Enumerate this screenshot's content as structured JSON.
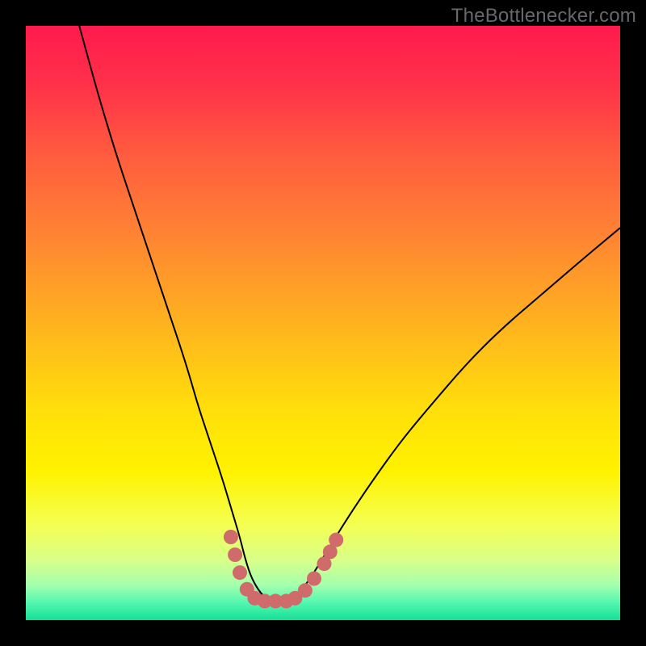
{
  "watermark": "TheBottlenecker.com",
  "gradient": {
    "stops": [
      {
        "offset": 0.0,
        "color": "#ff1a4d"
      },
      {
        "offset": 0.1,
        "color": "#ff3149"
      },
      {
        "offset": 0.22,
        "color": "#ff5d3e"
      },
      {
        "offset": 0.35,
        "color": "#ff8333"
      },
      {
        "offset": 0.5,
        "color": "#ffb21f"
      },
      {
        "offset": 0.65,
        "color": "#ffe00a"
      },
      {
        "offset": 0.75,
        "color": "#fff200"
      },
      {
        "offset": 0.84,
        "color": "#f4ff52"
      },
      {
        "offset": 0.9,
        "color": "#d8ff8a"
      },
      {
        "offset": 0.94,
        "color": "#a6ffad"
      },
      {
        "offset": 0.97,
        "color": "#55f7b0"
      },
      {
        "offset": 1.0,
        "color": "#16e097"
      }
    ]
  },
  "chart_data": {
    "type": "line",
    "title": "",
    "xlabel": "",
    "ylabel": "",
    "xlim": [
      0,
      100
    ],
    "ylim": [
      0,
      100
    ],
    "series": [
      {
        "name": "curve",
        "style": "thin-black",
        "x": [
          9,
          12,
          15,
          18,
          21,
          24,
          27,
          29,
          31,
          33,
          34.5,
          36,
          37,
          38,
          39.5,
          41,
          43,
          46,
          48,
          50,
          54,
          58,
          63,
          68,
          74,
          80,
          87,
          94,
          100
        ],
        "y": [
          100,
          89,
          79,
          70,
          61,
          52,
          43,
          36,
          30,
          24,
          19,
          14,
          10,
          7,
          4.5,
          3.2,
          3.2,
          4.6,
          7.2,
          10.5,
          17,
          23,
          30,
          36,
          43,
          49,
          55,
          61,
          66
        ]
      },
      {
        "name": "highlight-dots",
        "style": "pink-dots",
        "points": [
          {
            "x": 34.5,
            "y": 14.0
          },
          {
            "x": 35.2,
            "y": 11.0
          },
          {
            "x": 36.0,
            "y": 8.0
          },
          {
            "x": 37.2,
            "y": 5.2
          },
          {
            "x": 38.5,
            "y": 3.7
          },
          {
            "x": 40.2,
            "y": 3.2
          },
          {
            "x": 42.0,
            "y": 3.2
          },
          {
            "x": 43.8,
            "y": 3.2
          },
          {
            "x": 45.3,
            "y": 3.7
          },
          {
            "x": 47.0,
            "y": 5.0
          },
          {
            "x": 48.5,
            "y": 7.0
          },
          {
            "x": 50.2,
            "y": 9.5
          },
          {
            "x": 51.2,
            "y": 11.5
          },
          {
            "x": 52.2,
            "y": 13.5
          }
        ]
      }
    ]
  }
}
